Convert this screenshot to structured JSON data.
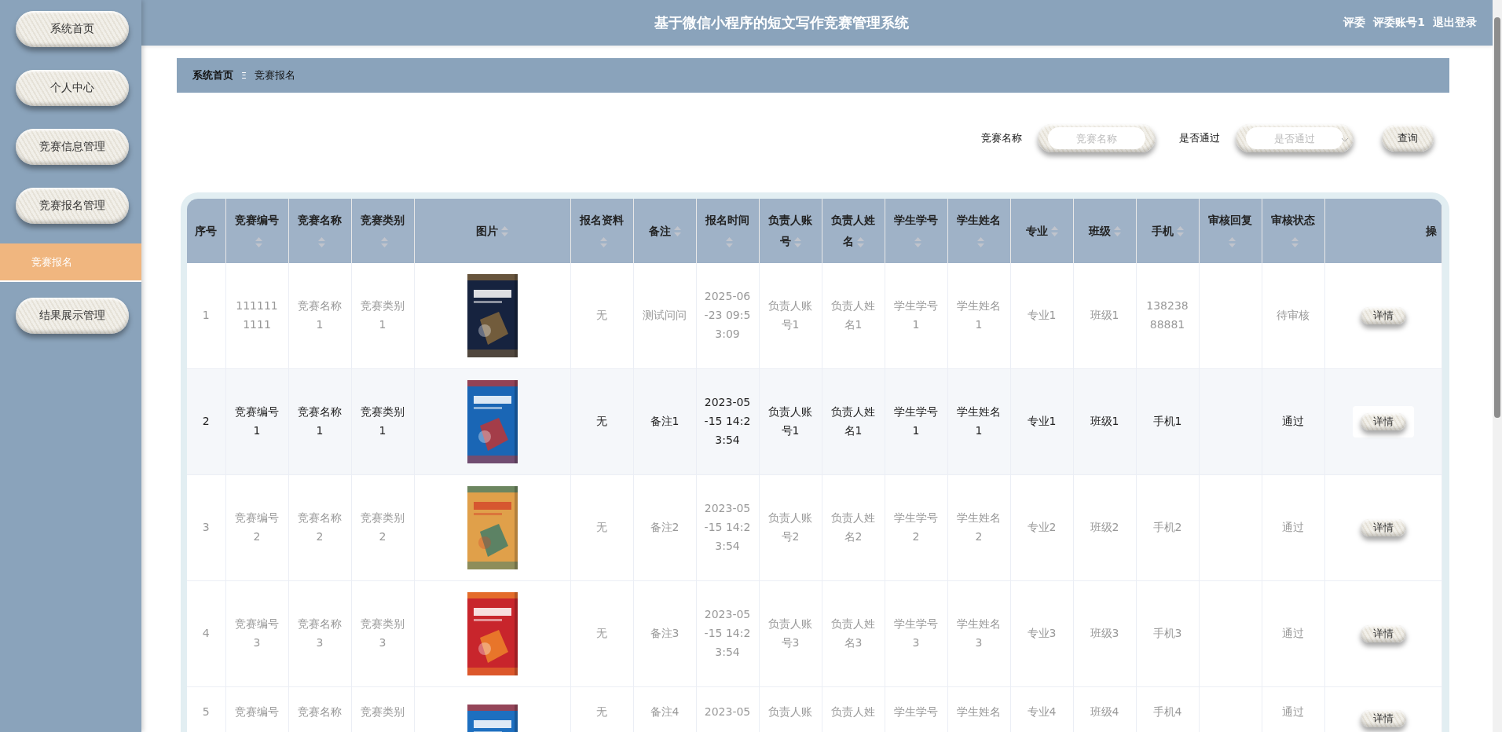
{
  "header": {
    "title": "基于微信小程序的短文写作竞赛管理系统",
    "role": "评委",
    "account": "评委账号1",
    "logout": "退出登录"
  },
  "sidebar": {
    "items": [
      {
        "label": "系统首页",
        "kind": "button",
        "selected": false
      },
      {
        "label": "个人中心",
        "kind": "button",
        "selected": false
      },
      {
        "label": "竞赛信息管理",
        "kind": "button",
        "selected": false
      },
      {
        "label": "竞赛报名管理",
        "kind": "button",
        "selected": false
      },
      {
        "label": "竞赛报名",
        "kind": "subitem",
        "selected": true
      },
      {
        "label": "结果展示管理",
        "kind": "button",
        "selected": false
      }
    ]
  },
  "breadcrumb": {
    "home": "系统首页",
    "separator": "Ξ",
    "current": "竞赛报名"
  },
  "search": {
    "fields": [
      {
        "label": "竞赛名称",
        "placeholder": "竞赛名称",
        "kind": "input"
      },
      {
        "label": "是否通过",
        "placeholder": "是否通过",
        "kind": "select"
      }
    ],
    "button": "查询"
  },
  "table": {
    "columns": [
      {
        "label": "序号",
        "kind": "index",
        "sortable": false
      },
      {
        "label": "竞赛编号",
        "kind": "text",
        "sortable": true
      },
      {
        "label": "竞赛名称",
        "kind": "text",
        "sortable": true
      },
      {
        "label": "竞赛类别",
        "kind": "text",
        "sortable": true
      },
      {
        "label": "图片",
        "kind": "picture",
        "sortable": true
      },
      {
        "label": "报名资料",
        "kind": "text",
        "sortable": true
      },
      {
        "label": "备注",
        "kind": "text",
        "sortable": true
      },
      {
        "label": "报名时间",
        "kind": "text",
        "sortable": true
      },
      {
        "label": "负责人账号",
        "kind": "text",
        "sortable": true
      },
      {
        "label": "负责人姓名",
        "kind": "text",
        "sortable": true
      },
      {
        "label": "学生学号",
        "kind": "text",
        "sortable": true
      },
      {
        "label": "学生姓名",
        "kind": "text",
        "sortable": true
      },
      {
        "label": "专业",
        "kind": "text",
        "sortable": true
      },
      {
        "label": "班级",
        "kind": "text",
        "sortable": true
      },
      {
        "label": "手机",
        "kind": "text",
        "sortable": true
      },
      {
        "label": "审核回复",
        "kind": "empty",
        "sortable": true
      },
      {
        "label": "审核状态",
        "kind": "text",
        "sortable": true
      },
      {
        "label": "操",
        "kind": "action",
        "sortable": false
      }
    ],
    "rows": [
      {
        "selected": false,
        "cut": false,
        "cells": [
          "1",
          "1111111111",
          "竞赛名称1",
          "竞赛类别1",
          "",
          "无",
          "测试问问",
          "2025-06-23 09:53:09",
          "负责人账号1",
          "负责人姓名1",
          "学生学号1",
          "学生姓名1",
          "专业1",
          "班级1",
          "13823888881",
          "",
          "待审核",
          "详情"
        ]
      },
      {
        "selected": true,
        "cut": false,
        "cells": [
          "2",
          "竞赛编号1",
          "竞赛名称1",
          "竞赛类别1",
          "",
          "无",
          "备注1",
          "2023-05-15 14:23:54",
          "负责人账号1",
          "负责人姓名1",
          "学生学号1",
          "学生姓名1",
          "专业1",
          "班级1",
          "手机1",
          "",
          "通过",
          "详情"
        ]
      },
      {
        "selected": false,
        "cut": false,
        "cells": [
          "3",
          "竞赛编号2",
          "竞赛名称2",
          "竞赛类别2",
          "",
          "无",
          "备注2",
          "2023-05-15 14:23:54",
          "负责人账号2",
          "负责人姓名2",
          "学生学号2",
          "学生姓名2",
          "专业2",
          "班级2",
          "手机2",
          "",
          "通过",
          "详情"
        ]
      },
      {
        "selected": false,
        "cut": false,
        "cells": [
          "4",
          "竞赛编号3",
          "竞赛名称3",
          "竞赛类别3",
          "",
          "无",
          "备注3",
          "2023-05-15 14:23:54",
          "负责人账号3",
          "负责人姓名3",
          "学生学号3",
          "学生姓名3",
          "专业3",
          "班级3",
          "手机3",
          "",
          "通过",
          "详情"
        ]
      },
      {
        "selected": false,
        "cut": true,
        "cells": [
          "5",
          "竞赛编号",
          "竞赛名称",
          "竞赛类别",
          "",
          "无",
          "备注4",
          "2023-05",
          "负责人账",
          "负责人姓",
          "学生学号",
          "学生姓名",
          "专业4",
          "班级4",
          "手机4",
          "",
          "通过",
          "详情"
        ]
      }
    ]
  }
}
